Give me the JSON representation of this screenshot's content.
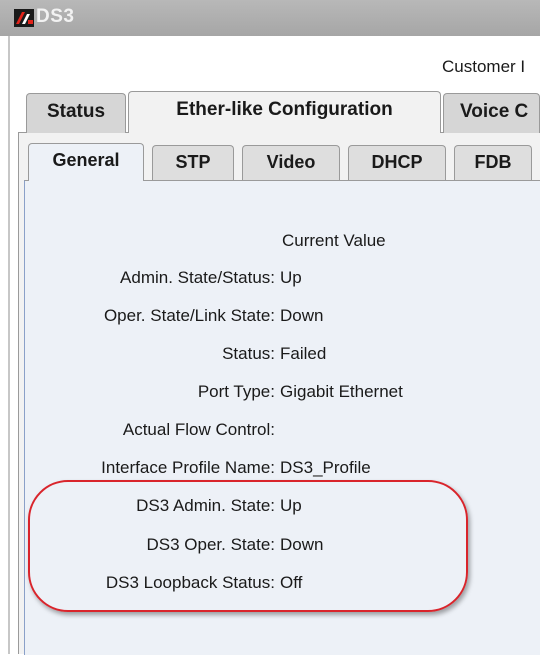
{
  "window": {
    "title": "DS3",
    "header_text": "Customer I"
  },
  "tabs_primary": [
    {
      "label": "Status",
      "active": false
    },
    {
      "label": "Ether-like Configuration",
      "active": true
    },
    {
      "label": "Voice C",
      "active": false
    }
  ],
  "tabs_secondary": [
    {
      "label": "General",
      "active": true
    },
    {
      "label": "STP",
      "active": false
    },
    {
      "label": "Video",
      "active": false
    },
    {
      "label": "DHCP",
      "active": false
    },
    {
      "label": "FDB",
      "active": false
    }
  ],
  "details": {
    "column_header": "Current Value",
    "fields": [
      {
        "label": "Admin. State/Status:",
        "value": "Up"
      },
      {
        "label": "Oper. State/Link State:",
        "value": "Down"
      },
      {
        "label": "Status:",
        "value": "Failed"
      },
      {
        "label": "Port Type:",
        "value": "Gigabit Ethernet"
      },
      {
        "label": "Actual Flow Control:",
        "value": ""
      },
      {
        "label": "Interface Profile Name:",
        "value": "DS3_Profile"
      },
      {
        "label": "DS3 Admin. State:",
        "value": "Up"
      },
      {
        "label": "DS3 Oper. State:",
        "value": "Down"
      },
      {
        "label": "DS3 Loopback Status:",
        "value": "Off"
      }
    ]
  },
  "colors": {
    "annotation": "#d9242b",
    "inner_panel": "#edf1f7",
    "titlebar": "#b0b0b0"
  }
}
